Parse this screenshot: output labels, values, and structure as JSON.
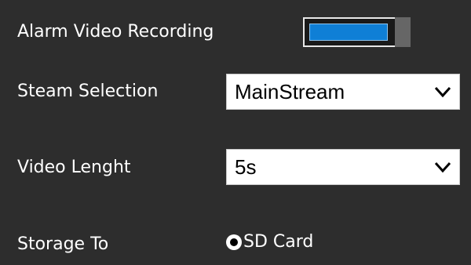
{
  "alarm_video_recording": {
    "label": "Alarm Video Recording",
    "enabled": true,
    "accent_color": "#0f7fd6"
  },
  "stream_selection": {
    "label": "Steam Selection",
    "value": "MainStream",
    "icon": "chevron-down-icon"
  },
  "video_length": {
    "label": "Video Lenght",
    "value": "5s",
    "icon": "chevron-down-icon"
  },
  "storage_to": {
    "label": "Storage To",
    "option_label": "SD Card",
    "selected": true
  }
}
